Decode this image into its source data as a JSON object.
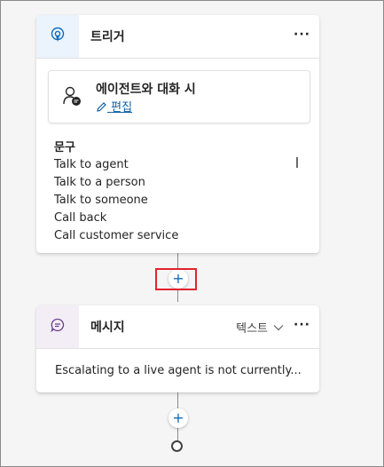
{
  "trigger_node": {
    "title": "트리거",
    "icon": "trigger-icon",
    "more_label": "···",
    "condition": {
      "title": "에이전트와 대화 시",
      "edit_label": "편집",
      "icon": "person-chat-icon"
    },
    "phrases_label": "문구",
    "phrases": [
      "Talk to agent",
      "Talk to a person",
      "Talk to someone",
      "Call back",
      "Call customer service"
    ]
  },
  "message_node": {
    "title": "메시지",
    "icon": "chat-bubble-icon",
    "type_label": "텍스트",
    "more_label": "···",
    "body": "Escalating to a live agent is not currently..."
  },
  "add_node_symbol": "+",
  "colors": {
    "accent": "#0f6cbd",
    "trigger_tile": "#ebf3fc",
    "message_tile": "#f3eef6",
    "highlight": "#e3242b"
  }
}
